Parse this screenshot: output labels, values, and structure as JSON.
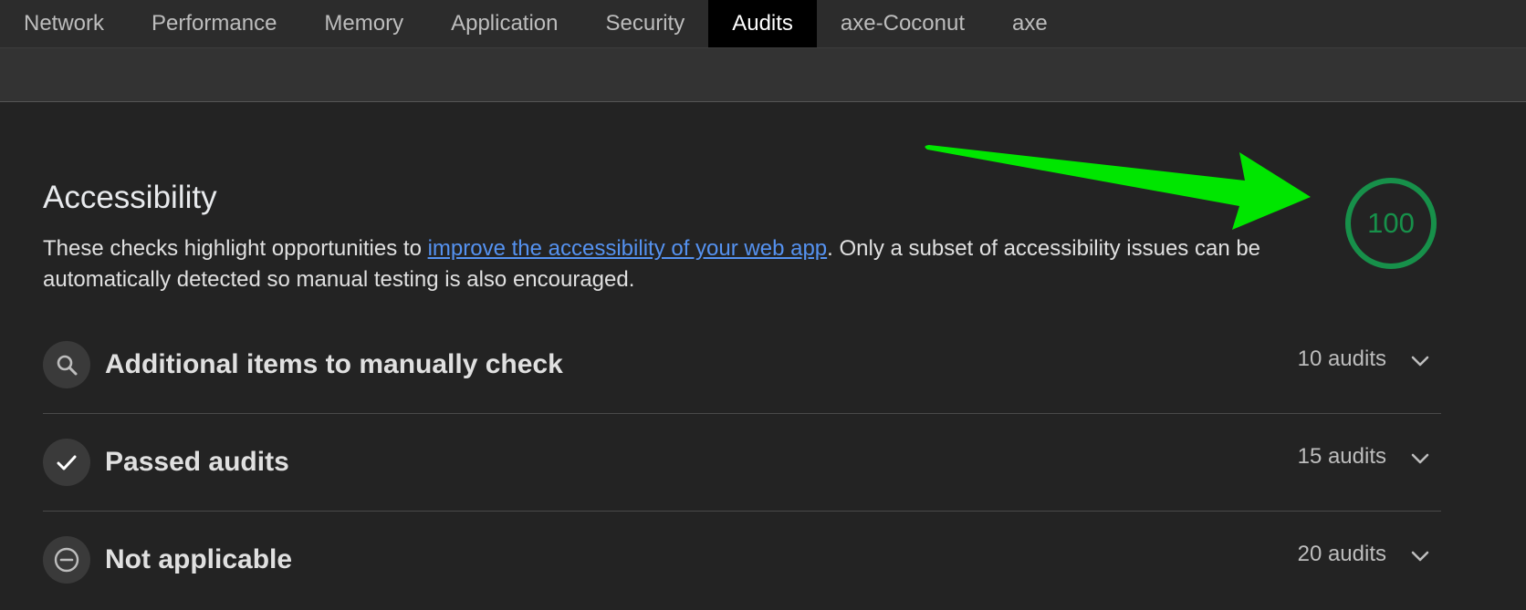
{
  "tabs": [
    {
      "label": "Network",
      "active": false
    },
    {
      "label": "Performance",
      "active": false
    },
    {
      "label": "Memory",
      "active": false
    },
    {
      "label": "Application",
      "active": false
    },
    {
      "label": "Security",
      "active": false
    },
    {
      "label": "Audits",
      "active": true
    },
    {
      "label": "axe-Coconut",
      "active": false
    },
    {
      "label": "axe",
      "active": false
    }
  ],
  "category": {
    "title": "Accessibility",
    "description_before": "These checks highlight opportunities to ",
    "description_link": "improve the accessibility of your web app",
    "description_after": ". Only a subset of accessibility issues can be automatically detected so manual testing is also encouraged.",
    "score": "100",
    "score_fraction": 1.0
  },
  "groups": [
    {
      "title": "Additional items to manually check",
      "count": "10 audits",
      "icon": "search-icon"
    },
    {
      "title": "Passed audits",
      "count": "15 audits",
      "icon": "checkmark-icon"
    },
    {
      "title": "Not applicable",
      "count": "20 audits",
      "icon": "minus-circle-icon"
    }
  ],
  "colors": {
    "score_green": "#17904a",
    "annotation_arrow": "#00e600",
    "link_blue": "#5592f0",
    "active_tab_bg": "#000000"
  }
}
